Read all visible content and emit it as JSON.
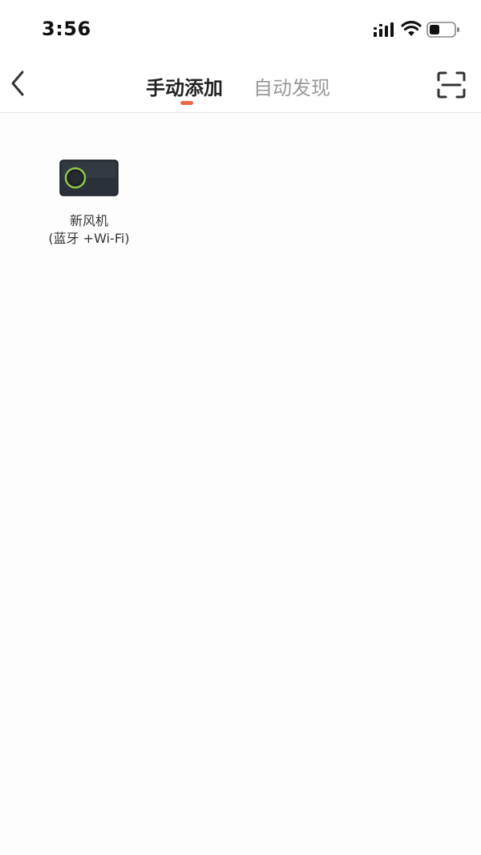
{
  "status_bar": {
    "time": "3:56",
    "icons": [
      "signal-icon",
      "wifi-icon",
      "battery-icon"
    ]
  },
  "nav": {
    "back_icon": "chevron-left-icon",
    "tabs": [
      {
        "label": "手动添加",
        "active": true
      },
      {
        "label": "自动发现",
        "active": false
      }
    ],
    "scan_icon": "scan-icon"
  },
  "devices": [
    {
      "name": "新风机",
      "connection": "(蓝牙 +Wi-Fi)",
      "icon": "fresh-air-device-icon"
    }
  ],
  "colors": {
    "accent": "#e8694a",
    "active_tab": "#222222",
    "inactive_tab": "#999999",
    "device_ring": "#8fc34a"
  }
}
